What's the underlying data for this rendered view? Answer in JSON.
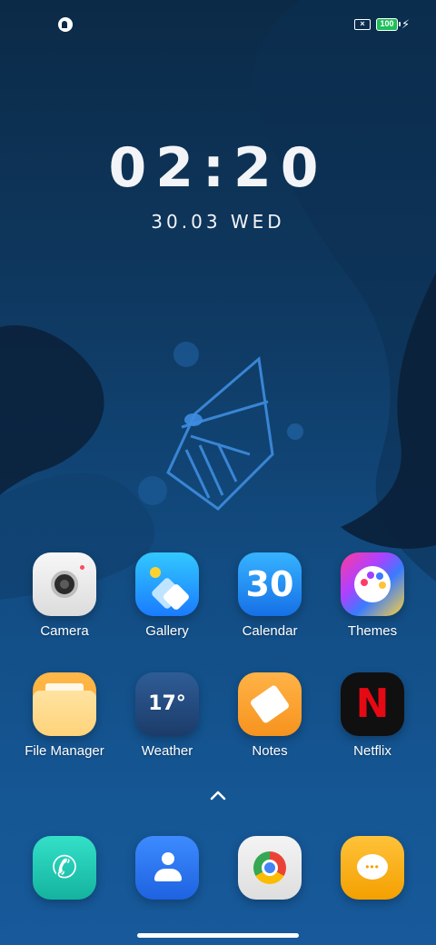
{
  "status_bar": {
    "sim_glyph": "×",
    "battery_level": "100",
    "charging_icon": "bolt-icon"
  },
  "lockscreen": {
    "time": "02:20",
    "date": "30.03 WED"
  },
  "apps_row1": [
    {
      "label": "Camera",
      "icon": "camera-icon"
    },
    {
      "label": "Gallery",
      "icon": "gallery-icon"
    },
    {
      "label": "Calendar",
      "icon": "calendar-icon",
      "icon_text": "30"
    },
    {
      "label": "Themes",
      "icon": "palette-icon"
    }
  ],
  "apps_row2": [
    {
      "label": "File Manager",
      "icon": "folder-icon"
    },
    {
      "label": "Weather",
      "icon": "weather-icon",
      "icon_text": "17°"
    },
    {
      "label": "Notes",
      "icon": "notes-icon"
    },
    {
      "label": "Netflix",
      "icon": "netflix-icon",
      "icon_text": "N"
    }
  ],
  "dock": [
    {
      "icon": "phone-icon"
    },
    {
      "icon": "contacts-icon"
    },
    {
      "icon": "chrome-icon"
    },
    {
      "icon": "messages-icon"
    }
  ],
  "colors": {
    "background_top": "#0b2a47",
    "background_bottom": "#17599a",
    "battery_green": "#1fbf5a",
    "netflix_red": "#e50914"
  }
}
